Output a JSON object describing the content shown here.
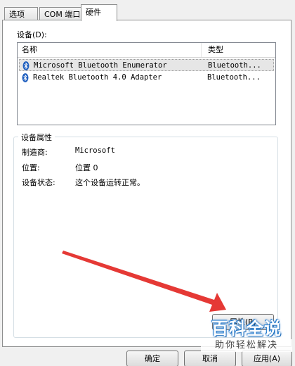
{
  "tabs": [
    {
      "label": "选项"
    },
    {
      "label": "COM 端口"
    },
    {
      "label": "硬件"
    }
  ],
  "devices_label": "设备(D):",
  "list": {
    "headers": {
      "name": "名称",
      "type": "类型"
    },
    "rows": [
      {
        "name": "Microsoft Bluetooth Enumerator",
        "type": "Bluetooth..."
      },
      {
        "name": "Realtek Bluetooth 4.0 Adapter",
        "type": "Bluetooth..."
      }
    ]
  },
  "properties": {
    "title": "设备属性",
    "items": [
      {
        "label": "制造商:",
        "value": "Microsoft"
      },
      {
        "label": "位置:",
        "value": "位置 0"
      },
      {
        "label": "设备状态:",
        "value": "这个设备运转正常。"
      }
    ],
    "properties_button": "属性(R)"
  },
  "buttons": {
    "ok": "确定",
    "cancel": "取消",
    "apply": "应用(A)"
  },
  "watermark": {
    "main": "百科全说",
    "sub": "助你轻松解决"
  },
  "colors": {
    "arrow": "#e53935",
    "watermark": "#2a7fd0"
  },
  "icons": {
    "device": "bluetooth-icon"
  }
}
